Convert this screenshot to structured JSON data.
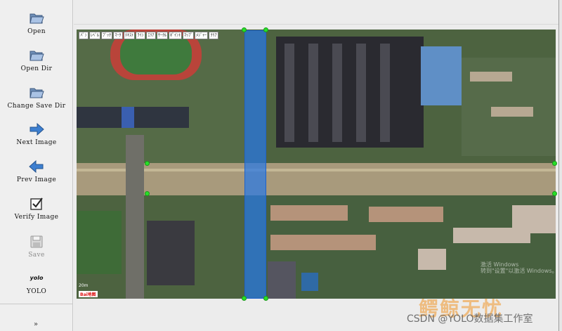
{
  "toolbar": {
    "open": "Open",
    "open_dir": "Open Dir",
    "change_save_dir": "Change Save Dir",
    "next_image": "Next Image",
    "prev_image": "Prev Image",
    "verify_image": "Verify Image",
    "save": "Save",
    "format_icon_text": "yolo",
    "format": "YOLO",
    "more": "»"
  },
  "map_tools": [
    "ﾊﾟﾝ",
    "ﾚﾍﾞﾙ",
    "ﾌﾞｯｸ",
    "ﾏｰｸ",
    "ﾃｷｽﾄ",
    "ﾗｲﾝ",
    "ｴﾘｱ",
    "ｻｰｸﾙ",
    "ﾎﾟｲﾝﾄ",
    "ﾏｯﾌﾟ",
    "ﾒｼﾞｬｰ",
    "ｸﾘｱ"
  ],
  "map_scale": "20m",
  "map_logo": "Bai地图",
  "os_watermark": {
    "line1": "激活 Windows",
    "line2": "转到\"设置\"以激活 Windows。"
  },
  "overlay_brand": "鳄鲸无忧",
  "credit": "CSDN @YOLO数据集工作室",
  "icons": {
    "open": "folder-open-icon",
    "open_dir": "folder-open-icon",
    "change_save_dir": "folder-open-icon",
    "next_image": "arrow-right-icon",
    "prev_image": "arrow-left-icon",
    "verify_image": "checkbox-checked-icon",
    "save": "floppy-disk-icon",
    "format": "yolo-format-icon"
  },
  "colors": {
    "bbox_fill": "#2878e6",
    "handle": "#28e028",
    "toolbar_bg": "#efefef"
  }
}
